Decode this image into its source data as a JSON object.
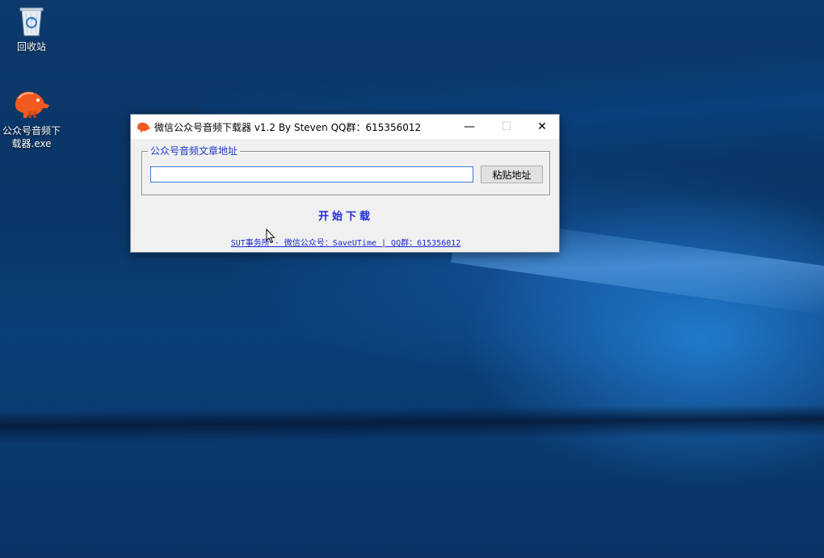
{
  "desktop": {
    "icons": [
      {
        "label": "回收站",
        "icon": "recycle-bin-icon"
      },
      {
        "label_line1": "公众号音频下",
        "label_line2": "载器.exe",
        "icon": "wechat-audio-downloader-icon"
      }
    ]
  },
  "window": {
    "title": "微信公众号音频下载器 v1.2 By Steven QQ群：615356012",
    "controls": {
      "minimize": "—",
      "maximize": "☐",
      "close": "✕"
    },
    "group_label": "公众号音频文章地址",
    "url_input": {
      "value": "",
      "placeholder": ""
    },
    "paste_button": "粘贴地址",
    "start_button": "开始下载",
    "footer_link": "SUT事务所 · 微信公众号：SaveUTime | QQ群：615356012"
  },
  "colors": {
    "accent_blue": "#1c2bd1",
    "group_label_blue": "#1c39c4",
    "input_focus_border": "#3b7bd4",
    "window_bg": "#f0f0f0",
    "app_icon_orange": "#f05a1e"
  }
}
